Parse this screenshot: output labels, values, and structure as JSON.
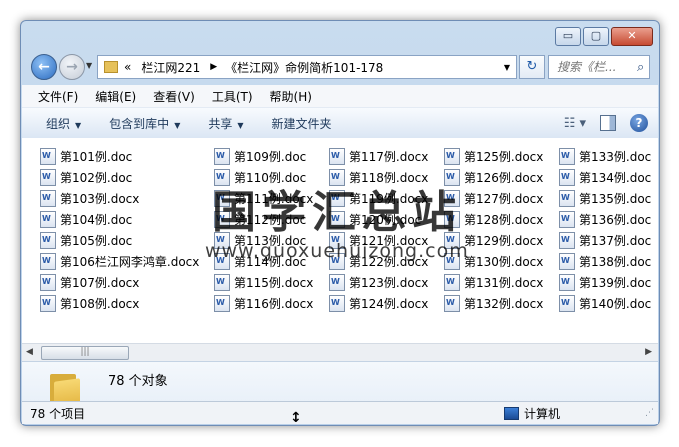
{
  "window": {
    "caption_buttons": [
      "▭",
      "▢",
      "✕"
    ]
  },
  "navigation": {
    "address": {
      "prefix": "«",
      "crumbs": [
        "栏江网221",
        "《栏江网》命例简析101-178"
      ]
    },
    "search_placeholder": "搜索《栏..."
  },
  "menu": [
    "文件(F)",
    "编辑(E)",
    "查看(V)",
    "工具(T)",
    "帮助(H)"
  ],
  "toolbar": {
    "organize": "组织",
    "include_library": "包含到库中",
    "share": "共享",
    "new_folder": "新建文件夹"
  },
  "files": {
    "columns": [
      [
        "第101例.doc",
        "第102例.doc",
        "第103例.docx",
        "第104例.doc",
        "第105例.doc",
        "第106栏江网李鸿章.docx",
        "第107例.docx",
        "第108例.docx"
      ],
      [
        "第109例.doc",
        "第110例.doc",
        "第111例.docx",
        "第112例.doc",
        "第113例.doc",
        "第114例.doc",
        "第115例.docx",
        "第116例.docx"
      ],
      [
        "第117例.docx",
        "第118例.docx",
        "第119例.docx",
        "第120例.doc",
        "第121例.docx",
        "第122例.docx",
        "第123例.docx",
        "第124例.docx"
      ],
      [
        "第125例.docx",
        "第126例.docx",
        "第127例.docx",
        "第128例.docx",
        "第129例.docx",
        "第130例.docx",
        "第131例.docx",
        "第132例.docx"
      ],
      [
        "第133例.doc",
        "第134例.doc",
        "第135例.doc",
        "第136例.doc",
        "第137例.doc",
        "第138例.doc",
        "第139例.doc",
        "第140例.doc"
      ]
    ]
  },
  "watermark": {
    "cn": "国学汇总站",
    "url": "www.guoxuehuizong.com"
  },
  "details": {
    "count": "78 个对象"
  },
  "status": {
    "items": "78 个项目",
    "location": "计算机"
  }
}
